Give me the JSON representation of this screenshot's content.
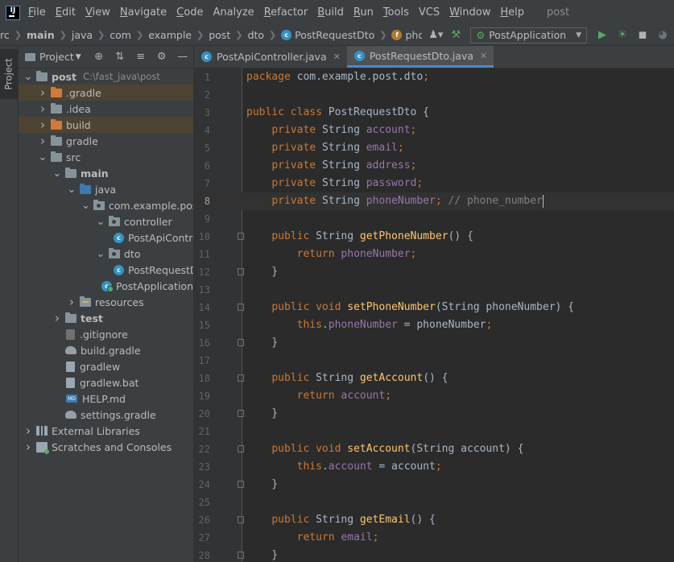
{
  "menubar": {
    "logo": "IJ",
    "items": [
      {
        "mnemonic": "F",
        "rest": "ile"
      },
      {
        "mnemonic": "E",
        "rest": "dit"
      },
      {
        "mnemonic": "V",
        "rest": "iew"
      },
      {
        "mnemonic": "N",
        "rest": "avigate"
      },
      {
        "mnemonic": "C",
        "rest": "ode"
      },
      {
        "mnemonic": "",
        "rest": "Analyze"
      },
      {
        "mnemonic": "R",
        "rest": "efactor"
      },
      {
        "mnemonic": "B",
        "rest": "uild"
      },
      {
        "mnemonic": "R",
        "rest": "un"
      },
      {
        "mnemonic": "T",
        "rest": "ools"
      },
      {
        "mnemonic": "",
        "rest": "VCS"
      },
      {
        "mnemonic": "W",
        "rest": "indow"
      },
      {
        "mnemonic": "H",
        "rest": "elp"
      }
    ],
    "project_name": "post"
  },
  "navbar": {
    "crumbs": [
      "rc",
      "main",
      "java",
      "com",
      "example",
      "post",
      "dto",
      "PostRequestDto",
      "phoneNumber"
    ],
    "run_config": "PostApplication",
    "icons": [
      "user-icon",
      "hammer-icon",
      "run-icon",
      "debug-icon",
      "coverage-icon",
      "profile-icon"
    ]
  },
  "side_stripe": {
    "project_tab": "Project"
  },
  "project_panel": {
    "title": "Project",
    "tree": [
      {
        "label": "post",
        "path": "C:\\fast_java\\post",
        "indent": 0,
        "arrow": "down",
        "icon": "folder",
        "bold": true
      },
      {
        "label": ".gradle",
        "indent": 1,
        "arrow": "right",
        "icon": "folder-orange",
        "excluded": true
      },
      {
        "label": ".idea",
        "indent": 1,
        "arrow": "right",
        "icon": "folder"
      },
      {
        "label": "build",
        "indent": 1,
        "arrow": "right",
        "icon": "folder-orange",
        "excluded": true
      },
      {
        "label": "gradle",
        "indent": 1,
        "arrow": "right",
        "icon": "folder"
      },
      {
        "label": "src",
        "indent": 1,
        "arrow": "down",
        "icon": "folder"
      },
      {
        "label": "main",
        "indent": 2,
        "arrow": "down",
        "icon": "folder",
        "bold": true
      },
      {
        "label": "java",
        "indent": 3,
        "arrow": "down",
        "icon": "folder-blue"
      },
      {
        "label": "com.example.post",
        "indent": 4,
        "arrow": "down",
        "icon": "package"
      },
      {
        "label": "controller",
        "indent": 5,
        "arrow": "down",
        "icon": "package"
      },
      {
        "label": "PostApiController",
        "indent": 6,
        "arrow": "none",
        "icon": "class"
      },
      {
        "label": "dto",
        "indent": 5,
        "arrow": "down",
        "icon": "package"
      },
      {
        "label": "PostRequestDto",
        "indent": 6,
        "arrow": "none",
        "icon": "class"
      },
      {
        "label": "PostApplication",
        "indent": 5,
        "arrow": "none",
        "icon": "class-app"
      },
      {
        "label": "resources",
        "indent": 3,
        "arrow": "right",
        "icon": "folder-res"
      },
      {
        "label": "test",
        "indent": 2,
        "arrow": "right",
        "icon": "folder",
        "bold": true
      },
      {
        "label": ".gitignore",
        "indent": 2,
        "arrow": "none",
        "icon": "file-git"
      },
      {
        "label": "build.gradle",
        "indent": 2,
        "arrow": "none",
        "icon": "gradle"
      },
      {
        "label": "gradlew",
        "indent": 2,
        "arrow": "none",
        "icon": "file"
      },
      {
        "label": "gradlew.bat",
        "indent": 2,
        "arrow": "none",
        "icon": "file"
      },
      {
        "label": "HELP.md",
        "indent": 2,
        "arrow": "none",
        "icon": "file-md"
      },
      {
        "label": "settings.gradle",
        "indent": 2,
        "arrow": "none",
        "icon": "gradle"
      },
      {
        "label": "External Libraries",
        "indent": 0,
        "arrow": "right",
        "icon": "library"
      },
      {
        "label": "Scratches and Consoles",
        "indent": 0,
        "arrow": "right",
        "icon": "scratch"
      }
    ]
  },
  "editor": {
    "tabs": [
      {
        "label": "PostApiController.java",
        "active": false
      },
      {
        "label": "PostRequestDto.java",
        "active": true
      }
    ],
    "current_line": 8,
    "lines": [
      {
        "n": 1,
        "fold": false,
        "tokens": [
          [
            "kw",
            "package "
          ],
          [
            "plain",
            "com.example.post.dto"
          ],
          [
            "kw",
            ";"
          ]
        ]
      },
      {
        "n": 2,
        "fold": false,
        "tokens": []
      },
      {
        "n": 3,
        "fold": false,
        "tokens": [
          [
            "kw",
            "public class "
          ],
          [
            "plain",
            "PostRequestDto {"
          ]
        ]
      },
      {
        "n": 4,
        "fold": false,
        "tokens": [
          [
            "plain",
            "    "
          ],
          [
            "kw",
            "private "
          ],
          [
            "plain",
            "String "
          ],
          [
            "fld",
            "account"
          ],
          [
            "kw",
            ";"
          ]
        ]
      },
      {
        "n": 5,
        "fold": false,
        "tokens": [
          [
            "plain",
            "    "
          ],
          [
            "kw",
            "private "
          ],
          [
            "plain",
            "String "
          ],
          [
            "fld",
            "email"
          ],
          [
            "kw",
            ";"
          ]
        ]
      },
      {
        "n": 6,
        "fold": false,
        "tokens": [
          [
            "plain",
            "    "
          ],
          [
            "kw",
            "private "
          ],
          [
            "plain",
            "String "
          ],
          [
            "fld",
            "address"
          ],
          [
            "kw",
            ";"
          ]
        ]
      },
      {
        "n": 7,
        "fold": false,
        "tokens": [
          [
            "plain",
            "    "
          ],
          [
            "kw",
            "private "
          ],
          [
            "plain",
            "String "
          ],
          [
            "fld",
            "password"
          ],
          [
            "kw",
            ";"
          ]
        ]
      },
      {
        "n": 8,
        "fold": false,
        "tokens": [
          [
            "plain",
            "    "
          ],
          [
            "kw",
            "private "
          ],
          [
            "plain",
            "String "
          ],
          [
            "fld",
            "phoneNumber"
          ],
          [
            "kw",
            "; "
          ],
          [
            "cmt",
            "// phone_number"
          ]
        ]
      },
      {
        "n": 9,
        "fold": false,
        "tokens": []
      },
      {
        "n": 10,
        "fold": true,
        "tokens": [
          [
            "plain",
            "    "
          ],
          [
            "kw",
            "public "
          ],
          [
            "plain",
            "String "
          ],
          [
            "mth",
            "getPhoneNumber"
          ],
          [
            "plain",
            "() {"
          ]
        ]
      },
      {
        "n": 11,
        "fold": false,
        "tokens": [
          [
            "plain",
            "        "
          ],
          [
            "kw",
            "return "
          ],
          [
            "fld",
            "phoneNumber"
          ],
          [
            "kw",
            ";"
          ]
        ]
      },
      {
        "n": 12,
        "fold": true,
        "tokens": [
          [
            "plain",
            "    }"
          ]
        ]
      },
      {
        "n": 13,
        "fold": false,
        "tokens": []
      },
      {
        "n": 14,
        "fold": true,
        "tokens": [
          [
            "plain",
            "    "
          ],
          [
            "kw",
            "public void "
          ],
          [
            "mth",
            "setPhoneNumber"
          ],
          [
            "plain",
            "(String phoneNumber) {"
          ]
        ]
      },
      {
        "n": 15,
        "fold": false,
        "tokens": [
          [
            "plain",
            "        "
          ],
          [
            "kw",
            "this"
          ],
          [
            "plain",
            "."
          ],
          [
            "fld",
            "phoneNumber"
          ],
          [
            "plain",
            " = phoneNumber"
          ],
          [
            "kw",
            ";"
          ]
        ]
      },
      {
        "n": 16,
        "fold": true,
        "tokens": [
          [
            "plain",
            "    }"
          ]
        ]
      },
      {
        "n": 17,
        "fold": false,
        "tokens": []
      },
      {
        "n": 18,
        "fold": true,
        "tokens": [
          [
            "plain",
            "    "
          ],
          [
            "kw",
            "public "
          ],
          [
            "plain",
            "String "
          ],
          [
            "mth",
            "getAccount"
          ],
          [
            "plain",
            "() {"
          ]
        ]
      },
      {
        "n": 19,
        "fold": false,
        "tokens": [
          [
            "plain",
            "        "
          ],
          [
            "kw",
            "return "
          ],
          [
            "fld",
            "account"
          ],
          [
            "kw",
            ";"
          ]
        ]
      },
      {
        "n": 20,
        "fold": true,
        "tokens": [
          [
            "plain",
            "    }"
          ]
        ]
      },
      {
        "n": 21,
        "fold": false,
        "tokens": []
      },
      {
        "n": 22,
        "fold": true,
        "tokens": [
          [
            "plain",
            "    "
          ],
          [
            "kw",
            "public void "
          ],
          [
            "mth",
            "setAccount"
          ],
          [
            "plain",
            "(String account) {"
          ]
        ]
      },
      {
        "n": 23,
        "fold": false,
        "tokens": [
          [
            "plain",
            "        "
          ],
          [
            "kw",
            "this"
          ],
          [
            "plain",
            "."
          ],
          [
            "fld",
            "account"
          ],
          [
            "plain",
            " = account"
          ],
          [
            "kw",
            ";"
          ]
        ]
      },
      {
        "n": 24,
        "fold": true,
        "tokens": [
          [
            "plain",
            "    }"
          ]
        ]
      },
      {
        "n": 25,
        "fold": false,
        "tokens": []
      },
      {
        "n": 26,
        "fold": true,
        "tokens": [
          [
            "plain",
            "    "
          ],
          [
            "kw",
            "public "
          ],
          [
            "plain",
            "String "
          ],
          [
            "mth",
            "getEmail"
          ],
          [
            "plain",
            "() {"
          ]
        ]
      },
      {
        "n": 27,
        "fold": false,
        "tokens": [
          [
            "plain",
            "        "
          ],
          [
            "kw",
            "return "
          ],
          [
            "fld",
            "email"
          ],
          [
            "kw",
            ";"
          ]
        ]
      },
      {
        "n": 28,
        "fold": true,
        "tokens": [
          [
            "plain",
            "    }"
          ]
        ]
      }
    ]
  }
}
